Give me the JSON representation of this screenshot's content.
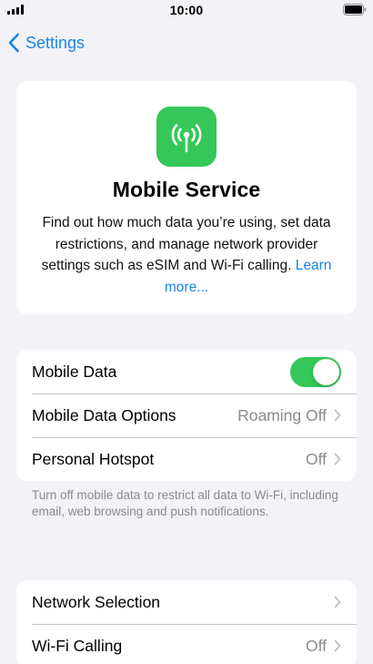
{
  "status_bar": {
    "time": "10:00",
    "signal_icon": "cellular-signal-icon",
    "battery_icon": "battery-icon"
  },
  "nav": {
    "back_label": "Settings",
    "back_icon": "chevron-left-icon"
  },
  "hero": {
    "icon": "antenna-icon",
    "icon_color": "#35c759",
    "title": "Mobile Service",
    "description": "Find out how much data you’re using, set data restrictions, and manage network provider settings such as eSIM and Wi-Fi calling.",
    "link": "Learn more..."
  },
  "group1": {
    "rows": [
      {
        "label": "Mobile Data",
        "toggle_on": true
      },
      {
        "label": "Mobile Data Options",
        "value": "Roaming Off"
      },
      {
        "label": "Personal Hotspot",
        "value": "Off"
      }
    ],
    "footnote": "Turn off mobile data to restrict all data to Wi-Fi, including email, web browsing and push notifications."
  },
  "group2": {
    "rows": [
      {
        "label": "Network Selection",
        "value": ""
      },
      {
        "label": "Wi-Fi Calling",
        "value": "Off"
      }
    ]
  },
  "colors": {
    "accent": "#1a84e6",
    "toggle_on": "#35c759",
    "background": "#f2f2f7",
    "secondary_text": "#8a8a8e"
  }
}
